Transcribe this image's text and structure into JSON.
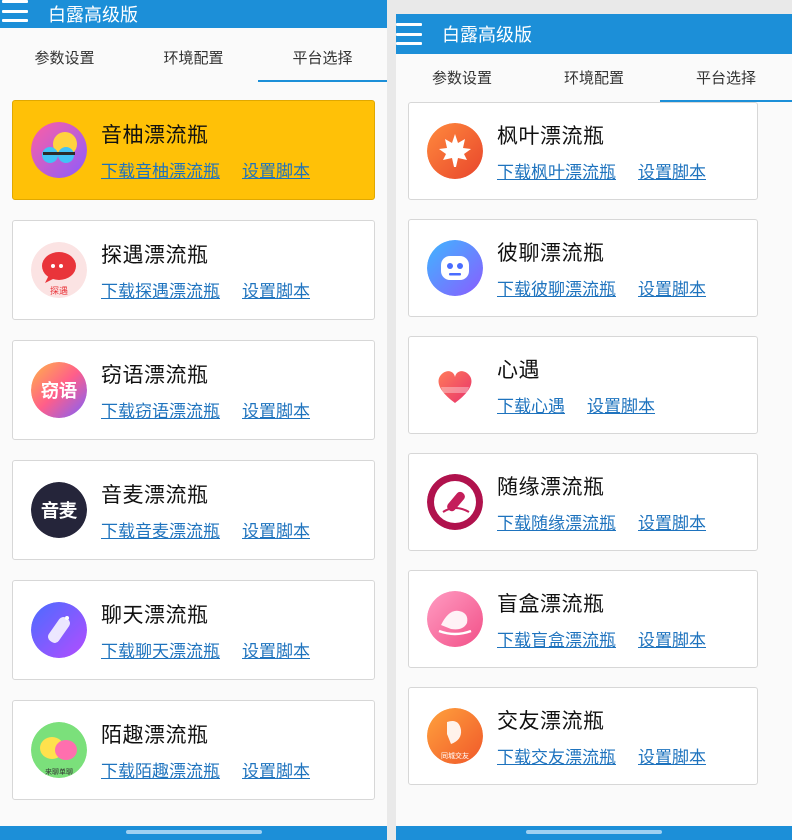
{
  "app": {
    "title": "白露高级版"
  },
  "tabs": [
    "参数设置",
    "环境配置",
    "平台选择"
  ],
  "common": {
    "setup_label": "设置脚本"
  },
  "colors": {
    "primary": "#1c8fd8",
    "highlight": "#ffc107",
    "link": "#1e73be"
  },
  "left_items": [
    {
      "name": "音柚漂流瓶",
      "download": "下载音柚漂流瓶",
      "icon": "yinyou-logo-icon",
      "selected": true
    },
    {
      "name": "探遇漂流瓶",
      "download": "下载探遇漂流瓶",
      "icon": "tanyu-logo-icon",
      "badge": "探遇"
    },
    {
      "name": "窃语漂流瓶",
      "download": "下载窃语漂流瓶",
      "icon": "qieyu-logo-icon",
      "badge": "窃语"
    },
    {
      "name": "音麦漂流瓶",
      "download": "下载音麦漂流瓶",
      "icon": "yinmai-logo-icon",
      "badge": "音麦"
    },
    {
      "name": "聊天漂流瓶",
      "download": "下载聊天漂流瓶",
      "icon": "liaotian-logo-icon"
    },
    {
      "name": "陌趣漂流瓶",
      "download": "下载陌趣漂流瓶",
      "icon": "moqu-logo-icon",
      "badge": "来聊单聊"
    }
  ],
  "right_items": [
    {
      "name": "枫叶漂流瓶",
      "download": "下载枫叶漂流瓶",
      "icon": "maple-leaf-icon"
    },
    {
      "name": "彼聊漂流瓶",
      "download": "下载彼聊漂流瓶",
      "icon": "robot-face-icon"
    },
    {
      "name": "心遇",
      "download": "下载心遇",
      "icon": "heart-icon"
    },
    {
      "name": "随缘漂流瓶",
      "download": "下载随缘漂流瓶",
      "icon": "bottle-icon"
    },
    {
      "name": "盲盒漂流瓶",
      "download": "下载盲盒漂流瓶",
      "icon": "mangbox-logo-icon"
    },
    {
      "name": "交友漂流瓶",
      "download": "下载交友漂流瓶",
      "icon": "jiaoyou-logo-icon",
      "badge": "同城交友"
    }
  ]
}
